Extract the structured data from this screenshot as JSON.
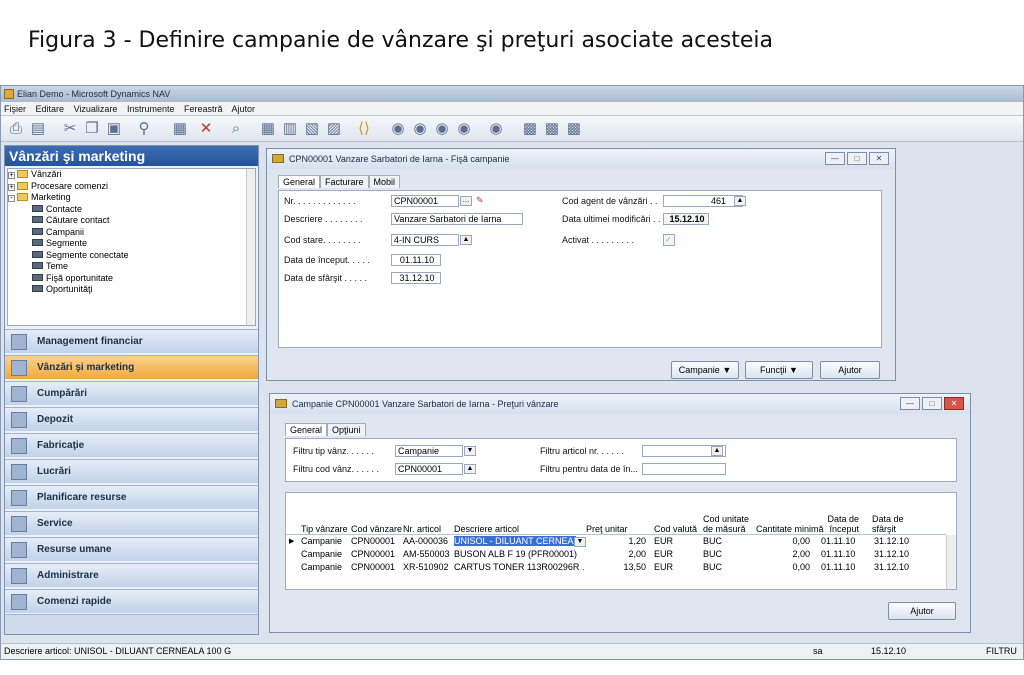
{
  "caption": "Figura 3 - Definire campanie de vânzare şi preţuri asociate acesteia",
  "window": {
    "title": "Elian Demo - Microsoft Dynamics NAV",
    "menu": [
      "Fişier",
      "Editare",
      "Vizualizare",
      "Instrumente",
      "Fereastră",
      "Ajutor"
    ]
  },
  "nav": {
    "header": "Vânzări şi marketing",
    "tree": [
      {
        "label": "Vânzări",
        "kind": "folder",
        "level": 0,
        "expander": "+"
      },
      {
        "label": "Procesare comenzi",
        "kind": "folder",
        "level": 0,
        "expander": "+"
      },
      {
        "label": "Marketing",
        "kind": "folder",
        "level": 0,
        "expander": "-"
      },
      {
        "label": "Contacte",
        "kind": "form",
        "level": 1
      },
      {
        "label": "Căutare contact",
        "kind": "form",
        "level": 1
      },
      {
        "label": "Campanii",
        "kind": "form",
        "level": 1
      },
      {
        "label": "Segmente",
        "kind": "form",
        "level": 1
      },
      {
        "label": "Segmente conectate",
        "kind": "form",
        "level": 1
      },
      {
        "label": "Teme",
        "kind": "form",
        "level": 1
      },
      {
        "label": "Fişă oportunitate",
        "kind": "form",
        "level": 1
      },
      {
        "label": "Oportunităţi",
        "kind": "form",
        "level": 1
      }
    ],
    "buttons": [
      "Management financiar",
      "Vânzări şi marketing",
      "Cumpărări",
      "Depozit",
      "Fabricaţie",
      "Lucrări",
      "Planificare resurse",
      "Service",
      "Resurse umane",
      "Administrare",
      "Comenzi rapide"
    ],
    "active_button": "Vânzări şi marketing"
  },
  "campaign_card": {
    "title": "CPN00001 Vanzare Sarbatori de Iarna - Fişă campanie",
    "tabs": [
      "General",
      "Facturare",
      "Mobil"
    ],
    "fields": {
      "nr_label": "Nr. . . . . . . . . . . . .",
      "nr_value": "CPN00001",
      "descriere_label": "Descriere . . . . . . . .",
      "descriere_value": "Vanzare Sarbatori de Iarna",
      "cod_stare_label": "Cod stare. . . . . . . .",
      "cod_stare_value": "4-IN CURS",
      "data_inceput_label": "Data de început. . . . .",
      "data_inceput_value": "01.11.10",
      "data_sfarsit_label": "Data de sfârşit . . . . .",
      "data_sfarsit_value": "31.12.10",
      "cod_agent_label": "Cod agent de vânzări . .",
      "cod_agent_value": "461",
      "data_modif_label": "Data ultimei modificări . .",
      "data_modif_value": "15.12.10",
      "activat_label": "Activat . . . . . . . . .",
      "activat_value": "✓"
    },
    "buttons": [
      "Campanie",
      "Funcţii",
      "Ajutor"
    ]
  },
  "price_card": {
    "title": "Campanie CPN00001 Vanzare Sarbatori de Iarna  - Preţuri vânzare",
    "tabs": [
      "General",
      "Opţiuni"
    ],
    "filters": {
      "tip_label": "Filtru tip vânz. . . . . .",
      "tip_value": "Campanie",
      "cod_label": "Filtru cod vânz. . . . . .",
      "cod_value": "CPN00001",
      "articol_label": "Filtru articol nr. . . . . .",
      "articol_value": "",
      "data_label": "Filtru pentru data de în...",
      "data_value": ""
    },
    "columns": [
      "Tip vânzare",
      "Cod vânzare",
      "Nr. articol",
      "Descriere articol",
      "Preţ unitar",
      "Cod valută",
      "Cod unitate de măsură",
      "Cantitate minimă",
      "Data de început",
      "Data de sfârşit"
    ],
    "rows": [
      [
        "Campanie",
        "CPN00001",
        "AA-000036",
        "UNISOL - DILUANT CERNEALA",
        "1,20",
        "EUR",
        "BUC",
        "0,00",
        "01.11.10",
        "31.12.10"
      ],
      [
        "Campanie",
        "CPN00001",
        "AM-550003",
        "BUSON ALB F 19 (PFR00001)",
        "2,00",
        "EUR",
        "BUC",
        "2,00",
        "01.11.10",
        "31.12.10"
      ],
      [
        "Campanie",
        "CPN00001",
        "XR-510902",
        "CARTUS TONER 113R00296R ...",
        "13,50",
        "EUR",
        "BUC",
        "0,00",
        "01.11.10",
        "31.12.10"
      ]
    ],
    "help_button": "Ajutor"
  },
  "status": {
    "left": "Descriere articol: UNISOL - DILUANT CERNEALA 100 G",
    "user": "sa",
    "date": "15.12.10",
    "mode": "FILTRU"
  }
}
